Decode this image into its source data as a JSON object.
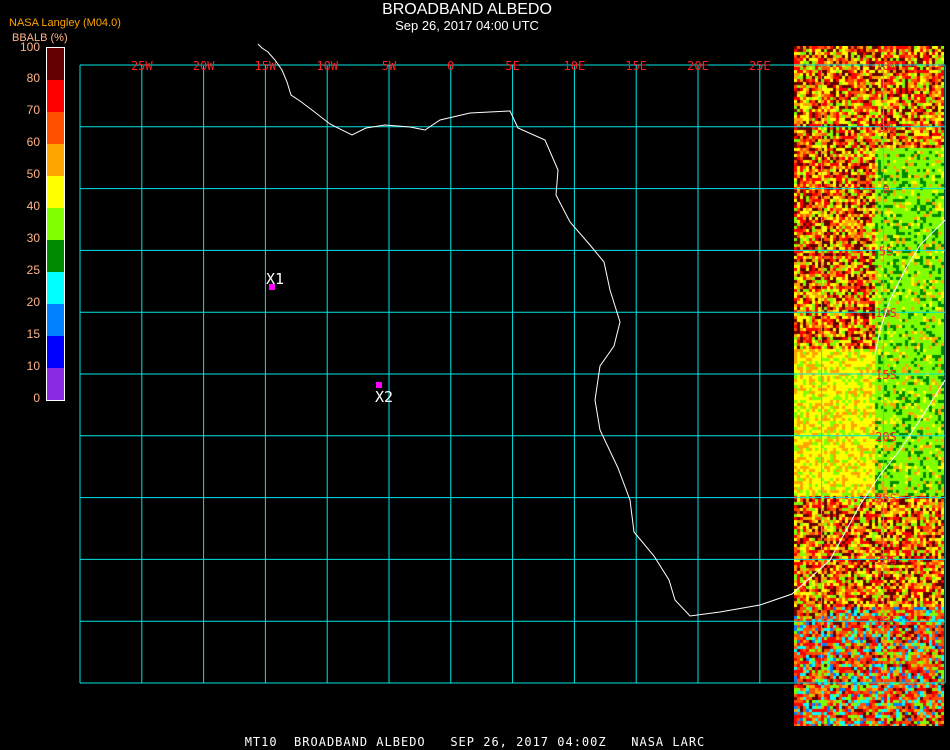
{
  "header": {
    "title": "BROADBAND ALBEDO",
    "subtitle": "Sep 26, 2017 04:00 UTC",
    "source": "NASA Langley (M04.0)",
    "unit_label": "BBALB (%)"
  },
  "legend": {
    "ticks": [
      "0",
      "10",
      "15",
      "20",
      "25",
      "30",
      "40",
      "50",
      "60",
      "70",
      "80",
      "100"
    ],
    "colors": [
      "#8a2be2",
      "#0000ff",
      "#0080ff",
      "#00ffff",
      "#008a00",
      "#80ff00",
      "#ffff00",
      "#ffa500",
      "#ff5000",
      "#ff0000",
      "#640000"
    ]
  },
  "map": {
    "lon_labels": [
      "25W",
      "20W",
      "15W",
      "10W",
      "5W",
      "0",
      "5E",
      "10E",
      "15E",
      "20E",
      "25E"
    ],
    "lat_labels": [
      "10N",
      "5N",
      "0",
      "5S",
      "10S",
      "15S",
      "20S",
      "25S",
      "30S",
      "35S"
    ],
    "grid_color": "#00e5e5",
    "label_color": "#ff2020",
    "markers": [
      {
        "label": "X1",
        "color": "#ff00ff"
      },
      {
        "label": "X2",
        "color": "#ff00ff"
      }
    ]
  },
  "footer": "MT10  BROADBAND ALBEDO   SEP 26, 2017 04:00Z   NASA LARC"
}
